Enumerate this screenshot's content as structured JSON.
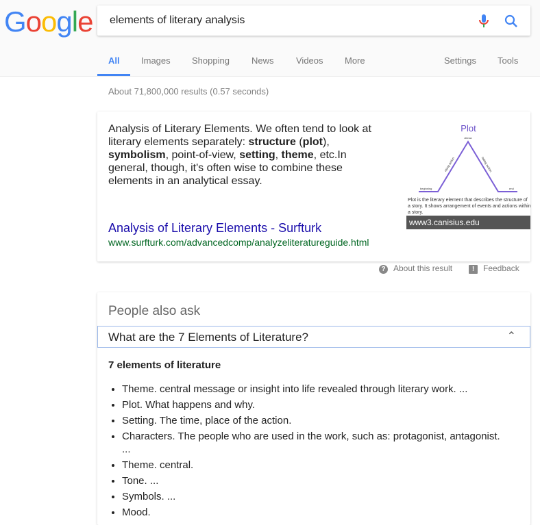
{
  "logo": "Google",
  "search": {
    "query": "elements of literary analysis"
  },
  "tabs": [
    "All",
    "Images",
    "Shopping",
    "News",
    "Videos",
    "More"
  ],
  "tools": [
    "Settings",
    "Tools"
  ],
  "result_stats": "About 71,800,000 results (0.57 seconds)",
  "featured": {
    "snippet_parts": [
      "Analysis of Literary Elements. We often tend to look at literary elements separately: ",
      "structure",
      " (",
      "plot",
      "), ",
      "symbolism",
      ", point-of-view, ",
      "setting",
      ", ",
      "theme",
      ", etc.In general, though, it's often wise to combine these elements in an analytical essay."
    ],
    "link": "Analysis of Literary Elements - Surfturk",
    "url": "www.surfturk.com/advancedcomp/analyzeliteratureguide.html",
    "image": {
      "title": "Plot",
      "labels": [
        "climax",
        "rising action",
        "falling action",
        "beginning",
        "exposition",
        "end",
        "resolution"
      ],
      "caption": "Plot is the literary element that describes the structure of a story. It shows arrangement of events and actions within a story.",
      "source": "www3.canisius.edu"
    }
  },
  "feedback": {
    "about": "About this result",
    "feedback": "Feedback"
  },
  "paa": {
    "title": "People also ask",
    "question": "What are the 7 Elements of Literature?",
    "answer_heading": "7 elements of literature",
    "items": [
      "Theme. central message or insight into life revealed through literary work. ...",
      "Plot. What happens and why.",
      "Setting. The time, place of the action.",
      "Characters. The people who are used in the work, such as: protagonist, antagonist. ...",
      "Theme. central.",
      "Tone. ...",
      "Symbols. ...",
      "Mood."
    ]
  },
  "colors": {
    "accent": "#4285f4",
    "link": "#1a0dab",
    "url": "#006621",
    "plot_line": "#7b5fd6"
  }
}
